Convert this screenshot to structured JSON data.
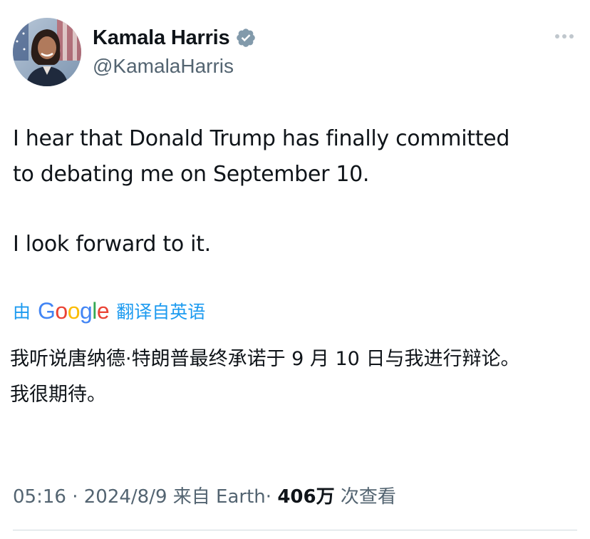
{
  "tweet": {
    "author": {
      "display_name": "Kamala Harris",
      "handle": "@KamalaHarris",
      "verified_icon": "verified-badge-icon",
      "verified_color": "#829aab"
    },
    "more_icon": "more-horizontal-icon",
    "text_lines": {
      "line1": "I hear that Donald Trump has finally committed",
      "line2": "to debating me on September 10.",
      "line3": "I look forward to it."
    },
    "translation": {
      "prefix": "由",
      "google_letters": [
        "G",
        "o",
        "o",
        "g",
        "l",
        "e"
      ],
      "suffix": "翻译自英语",
      "text": {
        "p1": "我听说唐纳德·特朗普最终承诺于 9 月 10 日与我进行辩论。",
        "p2": "我很期待。"
      }
    },
    "meta": {
      "time": "05:16",
      "date": "2024/8/9",
      "source": "来自 Earth",
      "sep": "·",
      "views": "406万",
      "views_label": "次查看"
    }
  },
  "colors": {
    "link": "#1d9bf0",
    "secondary_text": "#536471",
    "primary_text": "#0f1419"
  }
}
